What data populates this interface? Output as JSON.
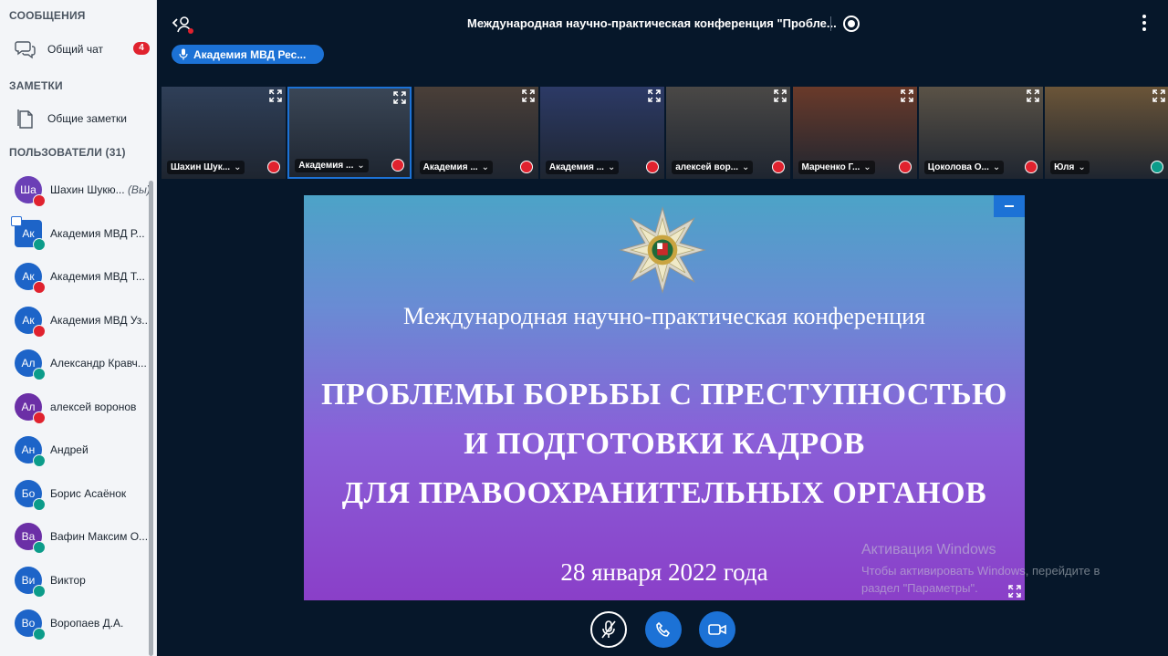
{
  "sidebar": {
    "messages_title": "СООБЩЕНИЯ",
    "public_chat": "Общий чат",
    "chat_badge": "4",
    "notes_title": "ЗАМЕТКИ",
    "shared_notes": "Общие заметки",
    "users_title": "ПОЛЬЗОВАТЕЛИ (31)",
    "users": [
      {
        "initials": "Ша",
        "name": "Шахин Шукю...",
        "you": "(Вы)",
        "color": "#6b3fb6",
        "status": "muted"
      },
      {
        "initials": "Ак",
        "name": "Академия МВД Р...",
        "color": "#1d64c8",
        "status": "listen",
        "presenter": true
      },
      {
        "initials": "Ак",
        "name": "Академия МВД Т...",
        "color": "#1d64c8",
        "status": "muted"
      },
      {
        "initials": "Ак",
        "name": "Академия МВД Уз...",
        "color": "#1d64c8",
        "status": "muted"
      },
      {
        "initials": "Ал",
        "name": "Александр Кравч...",
        "color": "#1d64c8",
        "status": "listen"
      },
      {
        "initials": "Ал",
        "name": "алексей воронов",
        "color": "#6b2fa6",
        "status": "muted"
      },
      {
        "initials": "Ан",
        "name": "Андрей",
        "color": "#1d64c8",
        "status": "listen"
      },
      {
        "initials": "Бо",
        "name": "Борис Асаёнок",
        "color": "#1d64c8",
        "status": "listen"
      },
      {
        "initials": "Ва",
        "name": "Вафин Максим О...",
        "color": "#6b2fa6",
        "status": "listen"
      },
      {
        "initials": "Ви",
        "name": "Виктор",
        "color": "#1d64c8",
        "status": "listen"
      },
      {
        "initials": "Во",
        "name": "Воропаев Д.А.",
        "color": "#1d64c8",
        "status": "listen"
      }
    ]
  },
  "topbar": {
    "title": "Международная научно-практическая конференция \"Пробле...",
    "presenter": "Академия МВД Рес..."
  },
  "tiles": [
    {
      "name": "Шахин Шук...",
      "status": "muted",
      "bg": "#2f3f58"
    },
    {
      "name": "Академия ...",
      "status": "muted",
      "bg": "#3a4656",
      "active": true
    },
    {
      "name": "Академия ...",
      "status": "muted",
      "bg": "#4a3f38"
    },
    {
      "name": "Академия ...",
      "status": "muted",
      "bg": "#2c3a66"
    },
    {
      "name": "алексей вор...",
      "status": "muted",
      "bg": "#4a4846"
    },
    {
      "name": "Марченко Г...",
      "status": "muted",
      "bg": "#6a3a2a"
    },
    {
      "name": "Цоколова О...",
      "status": "muted",
      "bg": "#5a5246"
    },
    {
      "name": "Юля",
      "status": "listen",
      "bg": "#6b5538"
    }
  ],
  "slide": {
    "conference": "Международная научно-практическая конференция",
    "title_lines": [
      "ПРОБЛЕМЫ БОРЬБЫ С ПРЕСТУПНОСТЬЮ",
      "И ПОДГОТОВКИ КАДРОВ",
      "ДЛЯ ПРАВООХРАНИТЕЛЬНЫХ ОРГАНОВ"
    ],
    "date": "28 января 2022 года"
  },
  "watermark": {
    "title": "Активация Windows",
    "subtitle": "Чтобы активировать Windows, перейдите в раздел \"Параметры\"."
  },
  "colors": {
    "accent": "#1c72d6",
    "muted": "#e0222e",
    "listen": "#0c9c8a",
    "background": "#06172a"
  },
  "icons": {
    "chat": "speech-bubbles-icon",
    "notes": "document-icon",
    "mic": "microphone-off-icon",
    "audio": "phone-icon",
    "video": "camera-icon",
    "fullscreen": "expand-icon"
  }
}
